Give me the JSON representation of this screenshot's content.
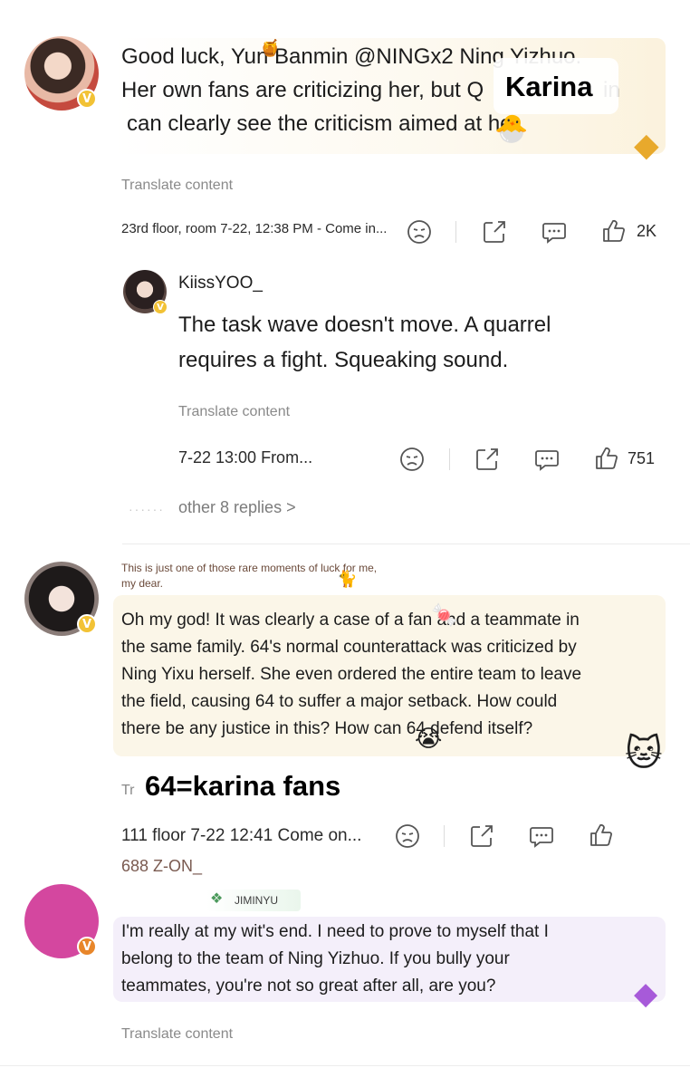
{
  "comments": [
    {
      "text": "Good luck, Yun Banmin @NINGx2 Ning Yizhuo. Her own fans are criticizing her, but Q... can clearly see the criticism aimed at her.",
      "line1": "Good luck, Yun Banmin @NINGx2 Ning Yizhuo.",
      "line2": "Her own fans are criticizing her, but Q",
      "line2_tail": "in",
      "line3": "can clearly see the criticism aimed at her.",
      "translate": "Translate content",
      "meta": "23rd floor, room 7-22, 12:38 PM - Come in...",
      "likes": "2K",
      "overlay": "Karina"
    },
    {
      "username": "KiissYOO_",
      "line1": "The task wave doesn't move. A quarrel",
      "line2": "requires a fight. Squeaking sound.",
      "translate": "Translate content",
      "meta": "7-22 13:00 From...",
      "likes": "751",
      "more_replies": "other 8 replies >"
    },
    {
      "caption_line1": "This is just one of those rare moments of luck for me,",
      "caption_line2": "my dear.",
      "line1": "Oh my god! It was clearly a case of a fan and a teammate in",
      "line2": "the same family. 64's normal counterattack was criticized by",
      "line3": "Ning Yixu herself. She even ordered the entire team to leave",
      "line4": "the field, causing 64 to suffer a major setback. How could",
      "line5": "there be any justice in this? How can 64 defend itself?",
      "translate_stub": "Tr",
      "overlay": "64=karina fans",
      "meta": "111 floor 7-22 12:41 Come on...",
      "username_below": "688 Z-ON_"
    },
    {
      "tag": "JIMINYU",
      "line1": "I'm really at my wit's end. I need to prove to myself that I",
      "line2": "belong to the team of Ning Yizhuo. If you bully your",
      "line3": "teammates, you're not so great after all, are you?",
      "translate": "Translate content"
    }
  ],
  "badge_letter": "V",
  "badge_letter_orange": "V",
  "colors": {
    "verified_yellow": "#f2c235",
    "verified_orange": "#e8862a",
    "bubble_cream": "#fbf6e8",
    "bubble_lilac": "#f4effa",
    "avatar_magenta": "#d4479f"
  }
}
